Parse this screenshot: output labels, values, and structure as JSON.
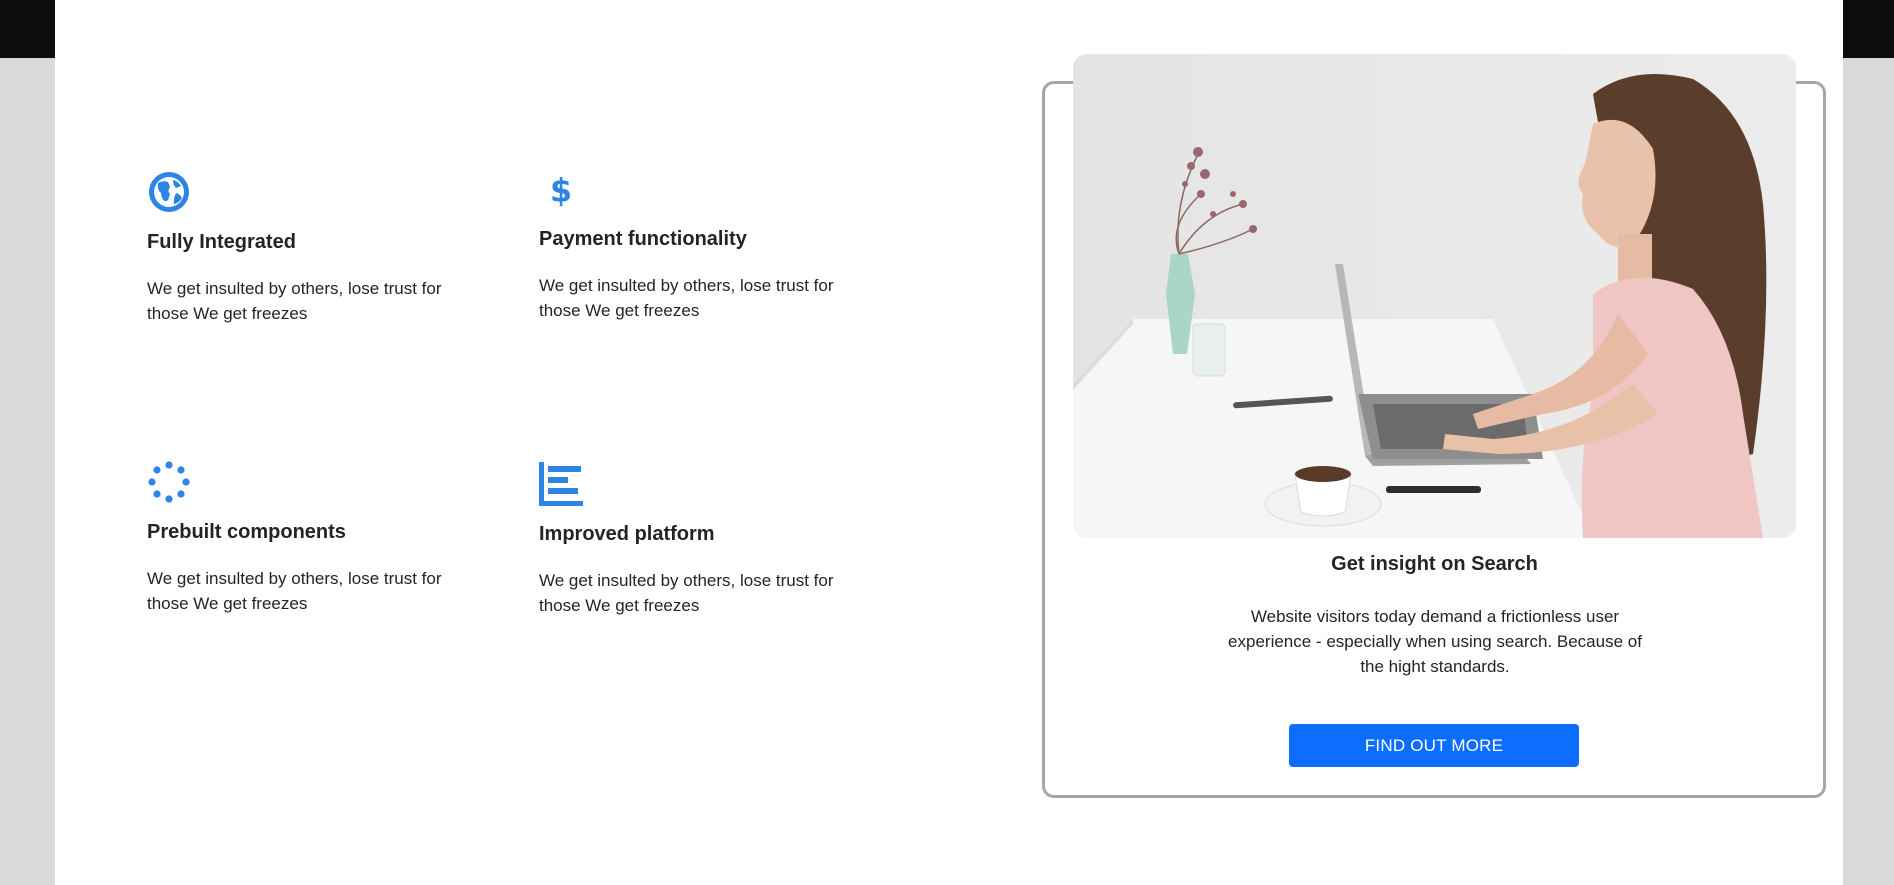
{
  "colors": {
    "accent": "#2b84e6",
    "button": "#0d6efd",
    "card_border": "#a6a6a6",
    "background": "#d9d9d9",
    "panel": "#ffffff",
    "top_bar": "#0c0c0c"
  },
  "features": [
    {
      "icon": "globe-icon",
      "title": "Fully Integrated",
      "text": "We get insulted by others, lose trust for those We get freezes"
    },
    {
      "icon": "dollar-icon",
      "title": "Payment functionality",
      "text": "We get insulted by others, lose trust for those We get freezes"
    },
    {
      "icon": "spinner-icon",
      "title": "Prebuilt components",
      "text": "We get insulted by others, lose trust for those We get freezes"
    },
    {
      "icon": "bar-chart-icon",
      "title": "Improved platform",
      "text": "We get insulted by others, lose trust for those We get freezes"
    }
  ],
  "card": {
    "image": "woman-typing-on-laptop-photo",
    "title": "Get insight on Search",
    "text": "Website visitors today demand a frictionless user experience - especially when using search. Because of the hight standards.",
    "button_label": "FIND OUT MORE"
  }
}
